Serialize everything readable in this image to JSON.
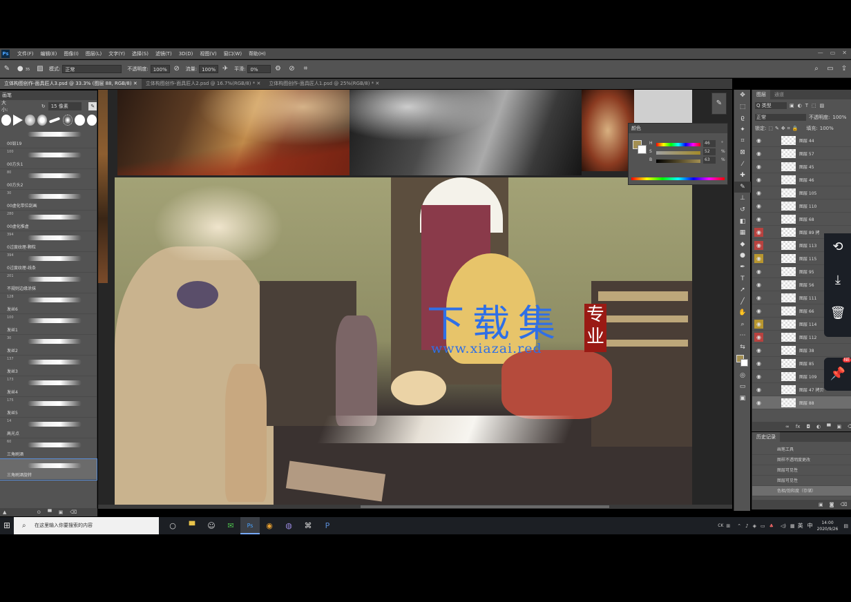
{
  "app": {
    "logo": "Ps"
  },
  "menu": [
    "文件(F)",
    "编辑(E)",
    "图像(I)",
    "图层(L)",
    "文字(Y)",
    "选择(S)",
    "滤镜(T)",
    "3D(D)",
    "视图(V)",
    "窗口(W)",
    "帮助(H)"
  ],
  "options": {
    "brush_size": "35",
    "mode_label": "模式:",
    "mode_value": "正常",
    "opacity_label": "不透明度:",
    "opacity_value": "100%",
    "flow_label": "流量:",
    "flow_value": "100%",
    "smooth_label": "平滑:",
    "smooth_value": "0%"
  },
  "tabs": [
    {
      "label": "立体构图创作-面具匠人3.psd @ 33.3% (图层 88, RGB/8)"
    },
    {
      "label": "立体构图创作-面具匠人2.psd @ 16.7%(RGB/8) *"
    },
    {
      "label": "立体构图创作-面具匠人1.psd @ 25%(RGB/8) *"
    }
  ],
  "brush_panel": {
    "title": "画笔",
    "size_label": "大小:",
    "size_value": "15 像素",
    "items": [
      {
        "num": "",
        "name": "00铅19"
      },
      {
        "num": "100",
        "name": "00方头1"
      },
      {
        "num": "80",
        "name": "00方头2"
      },
      {
        "num": "30",
        "name": "00虚化带位刮画"
      },
      {
        "num": "280",
        "name": "00虚化推虚"
      },
      {
        "num": "394",
        "name": "0过度纹理-颗粒"
      },
      {
        "num": "394",
        "name": "0过度纹理-线条"
      },
      {
        "num": "201",
        "name": "不规则边缘涂抹"
      },
      {
        "num": "128",
        "name": "发丝6"
      },
      {
        "num": "100",
        "name": "发丝1"
      },
      {
        "num": "30",
        "name": "发丝2"
      },
      {
        "num": "137",
        "name": "发丝3"
      },
      {
        "num": "173",
        "name": "发丝4"
      },
      {
        "num": "175",
        "name": "发丝5"
      },
      {
        "num": "14",
        "name": "高光点"
      },
      {
        "num": "60",
        "name": "三角刷酒"
      },
      {
        "num": "",
        "name": "三角刷酒旋转"
      }
    ]
  },
  "color_panel": {
    "title": "颜色",
    "h_label": "H",
    "h_value": "46",
    "s_label": "S",
    "s_value": "52",
    "b_label": "B",
    "b_value": "63",
    "deg": "°",
    "pct": "%"
  },
  "layers_panel": {
    "tab_layers": "图层",
    "tab_channels": "通道",
    "filter_label": "Q 类型",
    "blend_mode": "正常",
    "opacity_label": "不透明度:",
    "opacity_value": "100%",
    "lock_label": "锁定:",
    "fill_label": "填充:",
    "fill_value": "100%",
    "layers": [
      {
        "name": "图层 44",
        "mark": ""
      },
      {
        "name": "图层 57",
        "mark": ""
      },
      {
        "name": "图层 45",
        "mark": ""
      },
      {
        "name": "图层 46",
        "mark": ""
      },
      {
        "name": "图层 105",
        "mark": ""
      },
      {
        "name": "图层 110",
        "mark": ""
      },
      {
        "name": "图层 68",
        "mark": ""
      },
      {
        "name": "图层 89 拷",
        "mark": "red"
      },
      {
        "name": "图层 113",
        "mark": "red"
      },
      {
        "name": "图层 115",
        "mark": "yellow"
      },
      {
        "name": "图层 95",
        "mark": ""
      },
      {
        "name": "图层 56",
        "mark": ""
      },
      {
        "name": "图层 111",
        "mark": ""
      },
      {
        "name": "图层 66",
        "mark": ""
      },
      {
        "name": "图层 114",
        "mark": "yellow"
      },
      {
        "name": "图层 112",
        "mark": "red"
      },
      {
        "name": "图层 38",
        "mark": ""
      },
      {
        "name": "图层 85",
        "mark": ""
      },
      {
        "name": "图层 109",
        "mark": ""
      },
      {
        "name": "图层 47 拷贝",
        "mark": ""
      },
      {
        "name": "图层 88",
        "mark": ""
      }
    ]
  },
  "history_panel": {
    "title": "历史记录",
    "items": [
      "画笔工具",
      "图样不透明度更改",
      "图层可见性",
      "图层可见性",
      "色相/饱和度（存储）"
    ]
  },
  "watermark": {
    "cn": "下载集",
    "badge": "专业",
    "url": "www.xiazai.red"
  },
  "taskbar": {
    "search_placeholder": "在这里输入你要搜索的内容",
    "ime": "英",
    "ime2": "中",
    "ck": "CK",
    "time": "14:00",
    "date": "2020/9/26"
  },
  "side_badge": "NE"
}
